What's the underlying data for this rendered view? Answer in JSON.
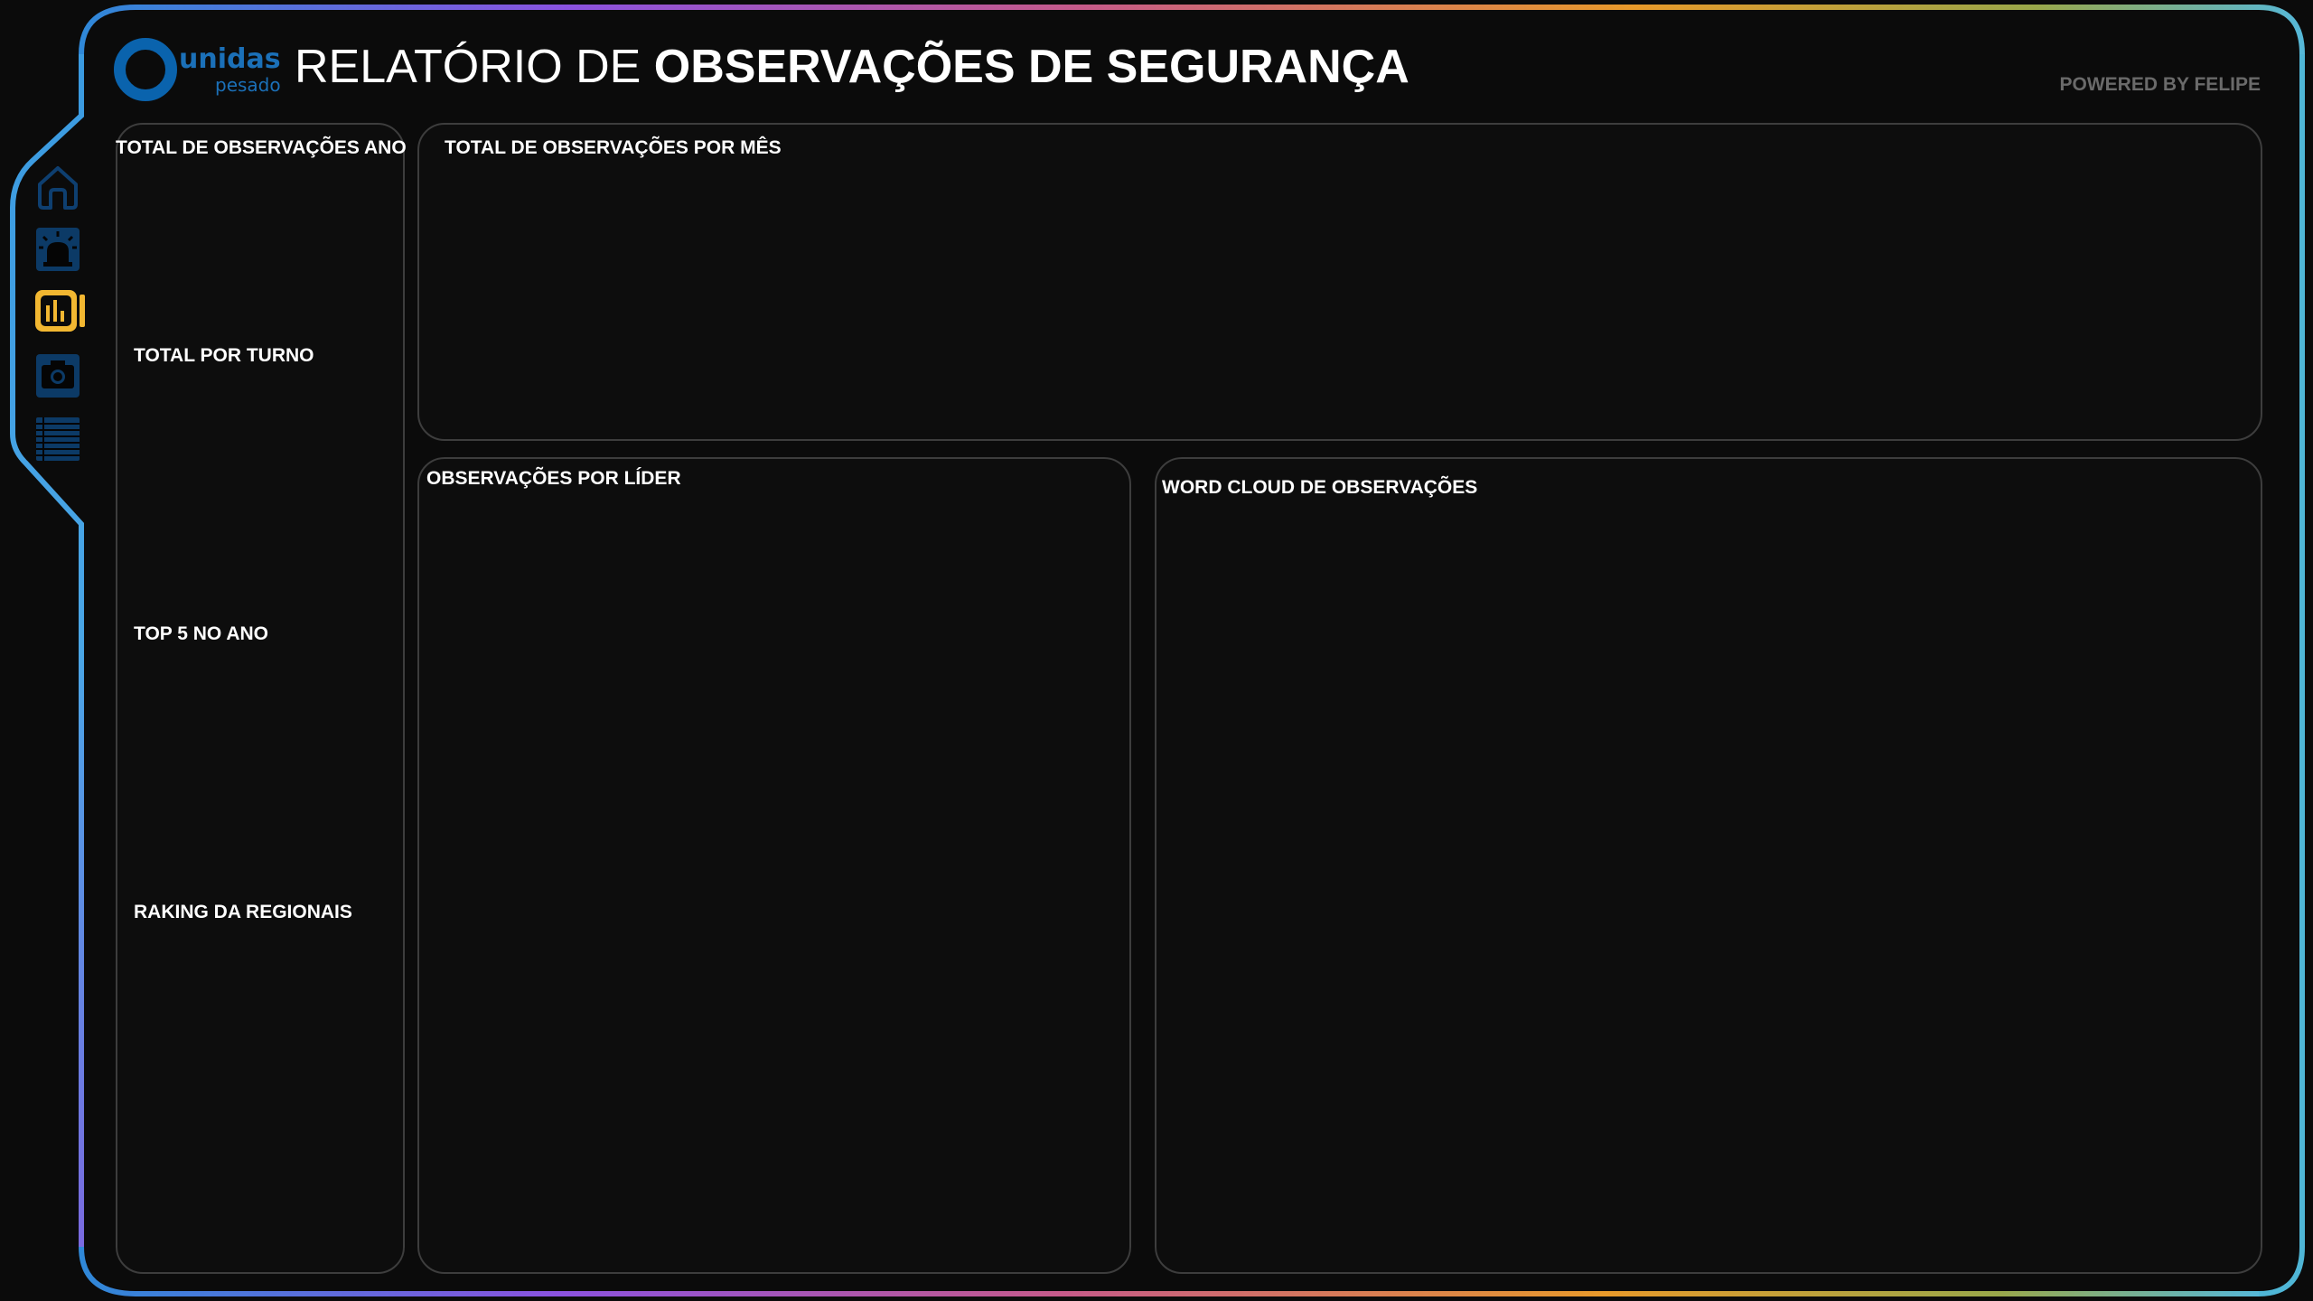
{
  "header": {
    "logo_word": "unidas",
    "logo_sub": "pesado",
    "title_light": "RELATÓRIO DE ",
    "title_bold": "OBSERVAÇÕES DE SEGURANÇA",
    "powered_by": "POWERED BY FELIPE"
  },
  "nav": {
    "items": [
      {
        "icon": "home-icon",
        "active": false
      },
      {
        "icon": "alarm-light-icon",
        "active": false
      },
      {
        "icon": "bar-chart-icon",
        "active": true
      },
      {
        "icon": "camera-icon",
        "active": false
      },
      {
        "icon": "list-icon",
        "active": false
      }
    ]
  },
  "left_panel": {
    "title": "TOTAL DE OBSERVAÇÕES ANO",
    "sections": [
      "TOTAL POR TURNO",
      "TOP 5 NO ANO",
      "RAKING DA REGIONAIS"
    ]
  },
  "panels": {
    "monthly_title": "TOTAL DE OBSERVAÇÕES POR MÊS",
    "leader_title": "OBSERVAÇÕES POR LÍDER",
    "wordcloud_title": "WORD CLOUD DE OBSERVAÇÕES"
  },
  "colors": {
    "background": "#0b0b0b",
    "panel_border": "#3d3d3d",
    "brand_blue": "#1b70b8",
    "nav_icon": "#0c3a66",
    "nav_active": "#f2b731",
    "frame_gradient": [
      "#3a8fd8",
      "#8a4fe0",
      "#c0508a",
      "#e89a2a",
      "#56b8d8"
    ]
  }
}
